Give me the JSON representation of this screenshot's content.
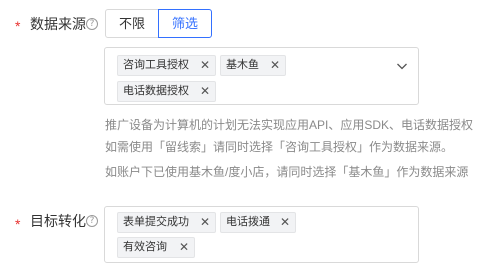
{
  "data_source": {
    "required_mark": "*",
    "label": "数据来源",
    "help_icon": "question-circle",
    "options": [
      "不限",
      "筛选"
    ],
    "selected": "筛选",
    "tags": [
      "咨询工具授权",
      "基木鱼",
      "电话数据授权"
    ],
    "remove_glyph": "✕",
    "hints": [
      "推广设备为计算机的计划无法实现应用API、应用SDK、电话数据授权",
      "如需使用「留线索」请同时选择「咨询工具授权」作为数据来源。",
      "如账户下已使用基木鱼/度小店，请同时选择「基木鱼」作为数据来源"
    ]
  },
  "target_conversion": {
    "required_mark": "*",
    "label": "目标转化",
    "help_icon": "question-circle",
    "tags": [
      "表单提交成功",
      "电话拨通",
      "有效咨询"
    ],
    "remove_glyph": "✕"
  },
  "colors": {
    "accent": "#3370ff",
    "required": "#e8312f",
    "hint": "#8a8a8a",
    "border": "#d9d9d9",
    "tag_bg": "#f2f3f5"
  }
}
